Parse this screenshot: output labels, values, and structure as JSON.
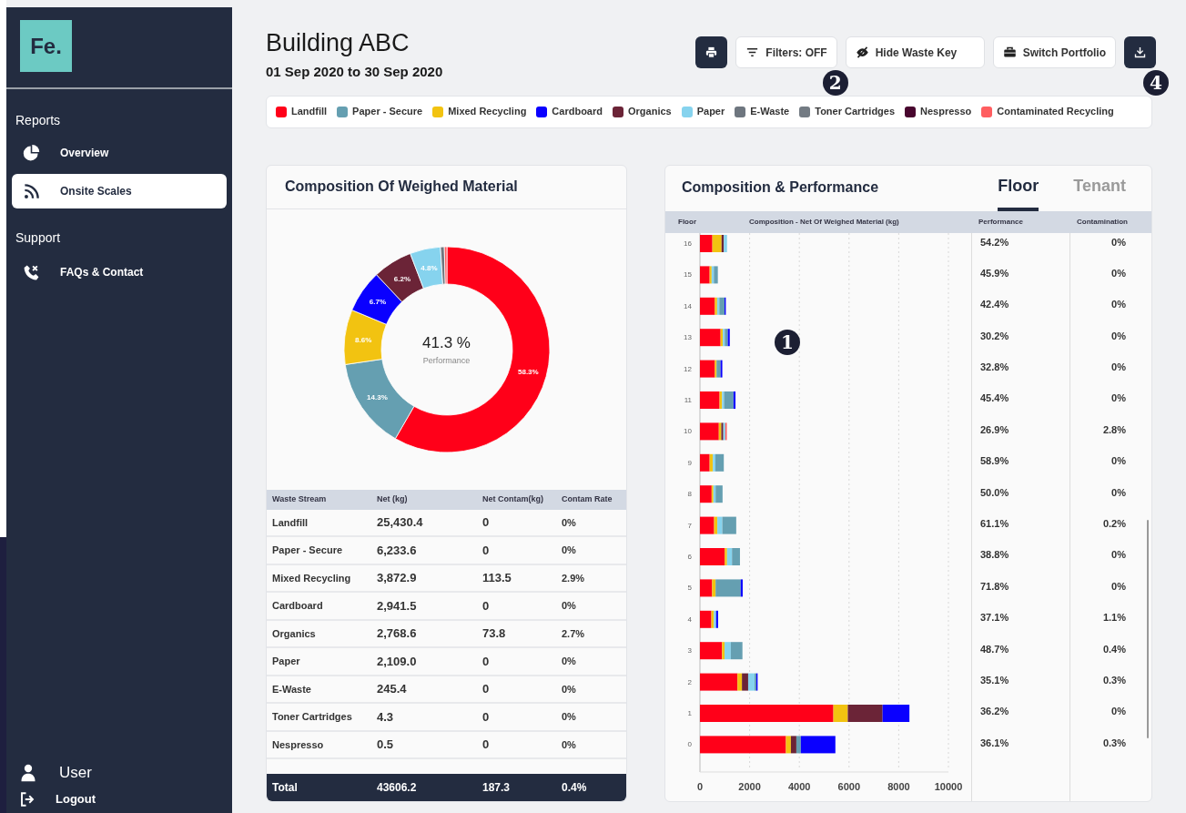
{
  "sidebar": {
    "logo": "Fe.",
    "sections": [
      {
        "heading": "Reports",
        "items": [
          {
            "label": "Overview",
            "selected": false
          },
          {
            "label": "Onsite Scales",
            "selected": true
          }
        ]
      },
      {
        "heading": "Support",
        "items": [
          {
            "label": "FAQs & Contact",
            "selected": false
          }
        ]
      }
    ],
    "user": "User",
    "logout": "Logout"
  },
  "header": {
    "title": "Building ABC",
    "date_range": "01 Sep 2020 to 30 Sep 2020"
  },
  "toolbar": [
    {
      "kind": "print"
    },
    {
      "kind": "filter",
      "label": "Filters: OFF",
      "callout": "2"
    },
    {
      "kind": "hide",
      "label": "Hide Waste Key"
    },
    {
      "kind": "portfolio",
      "label": "Switch Portfolio"
    },
    {
      "kind": "download",
      "callout": "4"
    }
  ],
  "legend": [
    {
      "label": "Landfill",
      "color": "#ff0019"
    },
    {
      "label": "Paper - Secure",
      "color": "#659fb1"
    },
    {
      "label": "Mixed Recycling",
      "color": "#f2c311"
    },
    {
      "label": "Cardboard",
      "color": "#0a00ff"
    },
    {
      "label": "Organics",
      "color": "#6b2437"
    },
    {
      "label": "Paper",
      "color": "#86d3ee"
    },
    {
      "label": "E-Waste",
      "color": "#6e767f"
    },
    {
      "label": "Toner Cartridges",
      "color": "#737b83"
    },
    {
      "label": "Nespresso",
      "color": "#48062e"
    },
    {
      "label": "Contaminated Recycling",
      "color": "#ff5e60"
    }
  ],
  "composition": {
    "title": "Composition Of Weighed Material",
    "center_value": "41.3 %",
    "center_label": "Performance",
    "chart_data": {
      "type": "donut",
      "values": [
        58.3,
        14.3,
        8.6,
        6.7,
        6.2,
        4.8,
        0.6,
        0.4
      ],
      "colors": [
        "#ff0019",
        "#659fb1",
        "#f2c311",
        "#0a00ff",
        "#6b2437",
        "#86d3ee",
        "#6e767f",
        "#ff5e60"
      ],
      "value_labels": [
        "58.3%",
        "14.3%",
        "8.6%",
        "6.7%",
        "6.2%",
        "4.8%",
        null,
        null
      ]
    },
    "table": {
      "columns": [
        "Waste Stream",
        "Net (kg)",
        "Net Contam(kg)",
        "Contam Rate"
      ],
      "rows": [
        [
          "Landfill",
          "25,430.4",
          "0",
          "0%"
        ],
        [
          "Paper - Secure",
          "6,233.6",
          "0",
          "0%"
        ],
        [
          "Mixed Recycling",
          "3,872.9",
          "113.5",
          "2.9%"
        ],
        [
          "Cardboard",
          "2,941.5",
          "0",
          "0%"
        ],
        [
          "Organics",
          "2,768.6",
          "73.8",
          "2.7%"
        ],
        [
          "Paper",
          "2,109.0",
          "0",
          "0%"
        ],
        [
          "E-Waste",
          "245.4",
          "0",
          "0%"
        ],
        [
          "Toner Cartridges",
          "4.3",
          "0",
          "0%"
        ],
        [
          "Nespresso",
          "0.5",
          "0",
          "0%"
        ]
      ],
      "total": [
        "Total",
        "43606.2",
        "187.3",
        "0.4%"
      ]
    }
  },
  "performance": {
    "title": "Composition & Performance",
    "tabs": [
      {
        "label": "Floor",
        "selected": true
      },
      {
        "label": "Tenant",
        "selected": false
      }
    ],
    "columns": [
      "Floor",
      "Composition - Net Of Weighed Material (kg)",
      "Performance",
      "Contamination"
    ],
    "callout": "1",
    "chart_data": {
      "type": "bar",
      "orientation": "horizontal",
      "stacked": true,
      "grid": true,
      "categories": [
        "16",
        "15",
        "14",
        "13",
        "12",
        "11",
        "10",
        "9",
        "8",
        "7",
        "6",
        "5",
        "4",
        "3",
        "2",
        "1",
        "0"
      ],
      "xlim": [
        0,
        10000
      ],
      "xticks": [
        0,
        2000,
        4000,
        6000,
        8000,
        10000
      ],
      "series": [
        {
          "color": "#ff0019",
          "values": [
            500,
            390,
            600,
            830,
            600,
            790,
            760,
            390,
            470,
            570,
            1000,
            490,
            460,
            890,
            1510,
            5370,
            3460
          ]
        },
        {
          "color": "#f2c311",
          "values": [
            370,
            80,
            90,
            90,
            70,
            100,
            100,
            130,
            70,
            130,
            90,
            140,
            100,
            100,
            180,
            580,
            200
          ]
        },
        {
          "color": "#6b2437",
          "values": [
            90,
            0,
            0,
            0,
            0,
            0,
            80,
            0,
            0,
            0,
            0,
            0,
            0,
            0,
            250,
            1400,
            220
          ]
        },
        {
          "color": "#86d3ee",
          "values": [
            130,
            90,
            90,
            80,
            0,
            80,
            80,
            100,
            90,
            200,
            200,
            0,
            90,
            250,
            260,
            0,
            0
          ]
        },
        {
          "color": "#659fb1",
          "values": [
            0,
            160,
            210,
            120,
            160,
            380,
            0,
            340,
            280,
            560,
            320,
            1010,
            0,
            470,
            70,
            0,
            180
          ]
        },
        {
          "color": "#0a00ff",
          "values": [
            0,
            0,
            50,
            80,
            70,
            80,
            0,
            0,
            0,
            0,
            0,
            80,
            80,
            0,
            50,
            1080,
            1390
          ]
        },
        {
          "color": "#ff5e60",
          "values": [
            0,
            0,
            0,
            0,
            0,
            0,
            60,
            0,
            0,
            0,
            0,
            0,
            0,
            0,
            0,
            0,
            0
          ]
        }
      ]
    },
    "rows": [
      [
        "54.2%",
        "0%"
      ],
      [
        "45.9%",
        "0%"
      ],
      [
        "42.4%",
        "0%"
      ],
      [
        "30.2%",
        "0%"
      ],
      [
        "32.8%",
        "0%"
      ],
      [
        "45.4%",
        "0%"
      ],
      [
        "26.9%",
        "2.8%"
      ],
      [
        "58.9%",
        "0%"
      ],
      [
        "50.0%",
        "0%"
      ],
      [
        "61.1%",
        "0.2%"
      ],
      [
        "38.8%",
        "0%"
      ],
      [
        "71.8%",
        "0%"
      ],
      [
        "37.1%",
        "1.1%"
      ],
      [
        "48.7%",
        "0.4%"
      ],
      [
        "35.1%",
        "0.3%"
      ],
      [
        "36.2%",
        "0%"
      ],
      [
        "36.1%",
        "0.3%"
      ]
    ]
  }
}
